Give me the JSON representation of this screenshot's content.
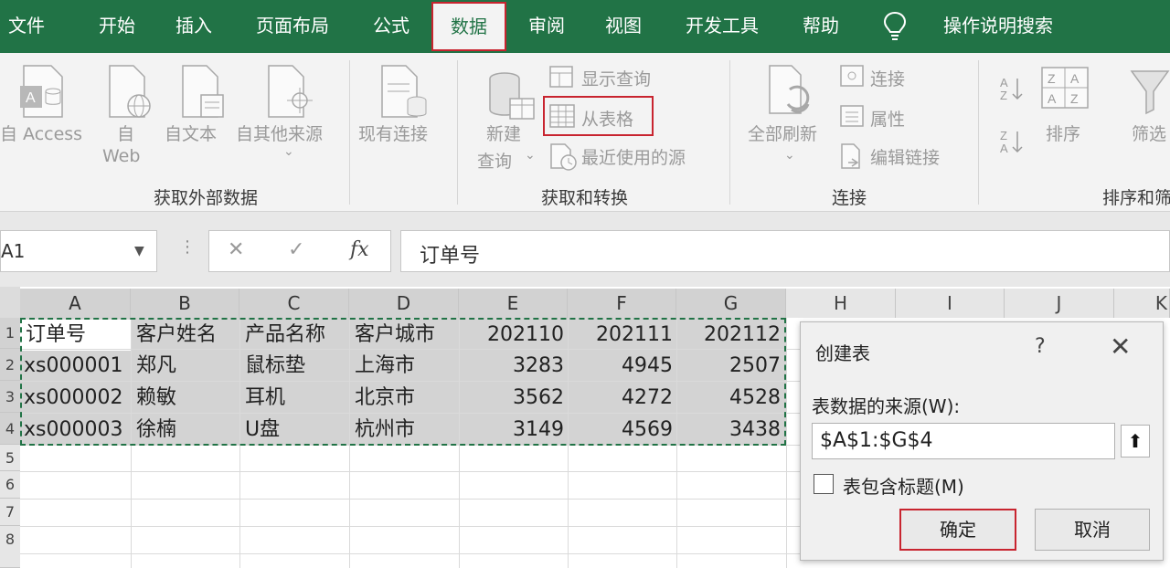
{
  "menu": {
    "tabs": [
      "文件",
      "开始",
      "插入",
      "页面布局",
      "公式",
      "数据",
      "审阅",
      "视图",
      "开发工具",
      "帮助"
    ],
    "active_tab": "数据",
    "tell_me": "操作说明搜索"
  },
  "ribbon": {
    "get_external": {
      "label": "获取外部数据",
      "access": "自 Access",
      "web_line1": "自",
      "web_line2": "Web",
      "text": "自文本",
      "other": "自其他来源",
      "existing": "现有连接"
    },
    "get_transform": {
      "label": "获取和转换",
      "new_query_line1": "新建",
      "new_query_line2": "查询",
      "show_queries": "显示查询",
      "from_table": "从表格",
      "recent_sources": "最近使用的源"
    },
    "connections": {
      "label": "连接",
      "refresh_all": "全部刷新",
      "connections": "连接",
      "properties": "属性",
      "edit_links": "编辑链接"
    },
    "sort_filter": {
      "label": "排序和筛",
      "sort": "排序",
      "filter": "筛选"
    }
  },
  "formula_bar": {
    "name_box": "A1",
    "formula": "订单号"
  },
  "sheet": {
    "columns": [
      "A",
      "B",
      "C",
      "D",
      "E",
      "F",
      "G",
      "H",
      "I",
      "J",
      "K"
    ],
    "rows": [
      "1",
      "2",
      "3",
      "4",
      "5",
      "6",
      "7",
      "8"
    ],
    "cells": [
      [
        "订单号",
        "客户姓名",
        "产品名称",
        "客户城市",
        "202110",
        "202111",
        "202112"
      ],
      [
        "xs000001",
        "郑凡",
        "鼠标垫",
        "上海市",
        "3283",
        "4945",
        "2507"
      ],
      [
        "xs000002",
        "赖敏",
        "耳机",
        "北京市",
        "3562",
        "4272",
        "4528"
      ],
      [
        "xs000003",
        "徐楠",
        "U盘",
        "杭州市",
        "3149",
        "4569",
        "3438"
      ]
    ]
  },
  "dialog": {
    "title": "创建表",
    "help": "?",
    "close": "✕",
    "source_label": "表数据的来源(W):",
    "source_value": "$A$1:$G$4",
    "has_headers_label": "表包含标题(M)",
    "has_headers_checked": false,
    "ok": "确定",
    "cancel": "取消"
  },
  "colors": {
    "excel_green": "#217346",
    "highlight_red": "#c8242f"
  }
}
